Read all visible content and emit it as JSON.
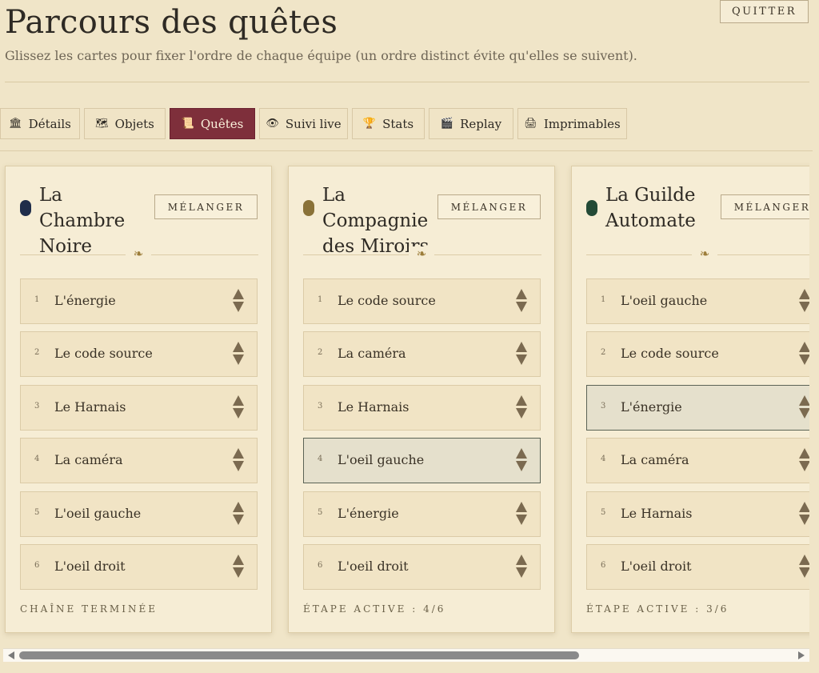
{
  "header": {
    "title": "Parcours des quêtes",
    "subtitle": "Glissez les cartes pour fixer l'ordre de chaque équipe (un ordre distinct évite qu'elles se suivent).",
    "quit_label": "QUITTER"
  },
  "tabs": [
    {
      "label": "Détails",
      "icon": "building-icon",
      "glyph": "🏛"
    },
    {
      "label": "Objets",
      "icon": "map-icon",
      "glyph": "🗺"
    },
    {
      "label": "Quêtes",
      "icon": "scroll-icon",
      "glyph": "📜",
      "active": true
    },
    {
      "label": "Suivi live",
      "icon": "eye-icon",
      "glyph": "👁"
    },
    {
      "label": "Stats",
      "icon": "trophy-icon",
      "glyph": "🏆"
    },
    {
      "label": "Replay",
      "icon": "clapper-icon",
      "glyph": "🎬"
    },
    {
      "label": "Imprimables",
      "icon": "printer-icon",
      "glyph": "🖨"
    }
  ],
  "shuffle_label": "MÉLANGER",
  "fleuron": "❧",
  "teams": [
    {
      "name": "La Chambre Noire",
      "color": "#1f2d4a",
      "active_index": -1,
      "status": "CHAÎNE TERMINÉE",
      "items": [
        "L'énergie",
        "Le code source",
        "Le Harnais",
        "La caméra",
        "L'oeil gauche",
        "L'oeil droit"
      ]
    },
    {
      "name": "La Compagnie des Miroirs",
      "color": "#8a7238",
      "active_index": 3,
      "status": "ÉTAPE ACTIVE : 4/6",
      "items": [
        "Le code source",
        "La caméra",
        "Le Harnais",
        "L'oeil gauche",
        "L'énergie",
        "L'oeil droit"
      ]
    },
    {
      "name": "La Guilde Automate",
      "color": "#234a36",
      "active_index": 2,
      "status": "ÉTAPE ACTIVE : 3/6",
      "items": [
        "L'oeil gauche",
        "Le code source",
        "L'énergie",
        "La caméra",
        "Le Harnais",
        "L'oeil droit"
      ]
    }
  ],
  "numbers": [
    "1",
    "2",
    "3",
    "4",
    "5",
    "6"
  ]
}
